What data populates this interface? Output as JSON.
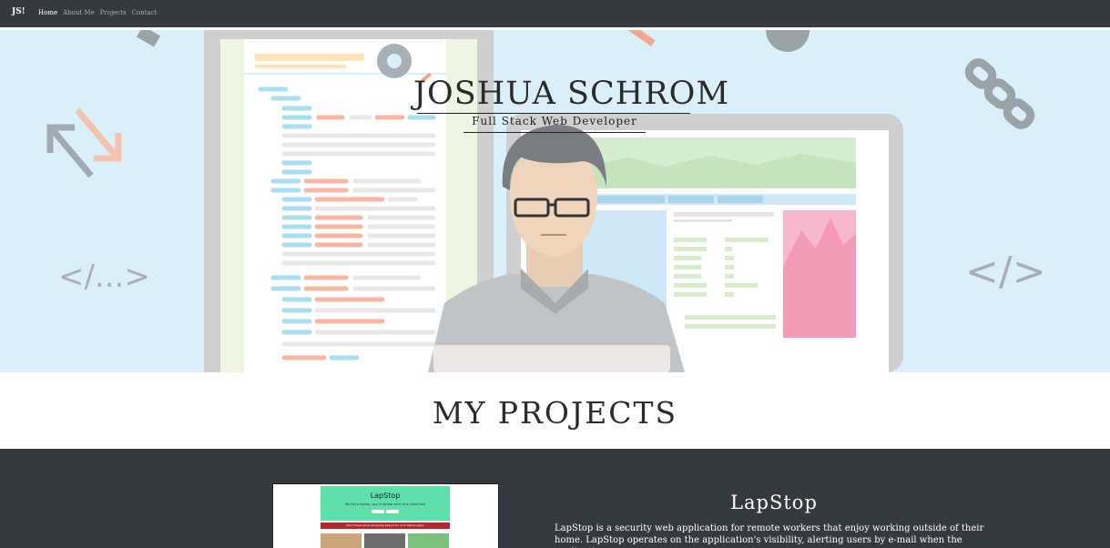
{
  "nav": {
    "brand": "JS!",
    "links": [
      {
        "label": "Home",
        "active": true
      },
      {
        "label": "About Me",
        "active": false
      },
      {
        "label": "Projects",
        "active": false
      },
      {
        "label": "Contact",
        "active": false
      }
    ]
  },
  "hero": {
    "title": "JOSHUA SCHROM",
    "subtitle": "Full Stack Web Developer",
    "decor_left_code": "</...>",
    "decor_right_code": "</>"
  },
  "projects": {
    "heading": "MY PROJECTS",
    "items": [
      {
        "title": "LapStop",
        "description": "LapStop is a security web application for remote workers that enjoy working outside of their home. LapStop operates on the application's visibility, alerting users by e-mail when the application goes",
        "thumb": {
          "title": "LapStop",
          "subtitle": "We left a laptop, spy in laptop alert at a meantime",
          "bar_text": "Don't leave alone shopping away from your laptop again"
        }
      }
    ]
  },
  "colors": {
    "navbar": "#343a40",
    "hero_bg": "#d9effa",
    "project_bg": "#343a40",
    "thumb_accent": "#5fe0aa",
    "thumb_bar": "#b0292b"
  }
}
